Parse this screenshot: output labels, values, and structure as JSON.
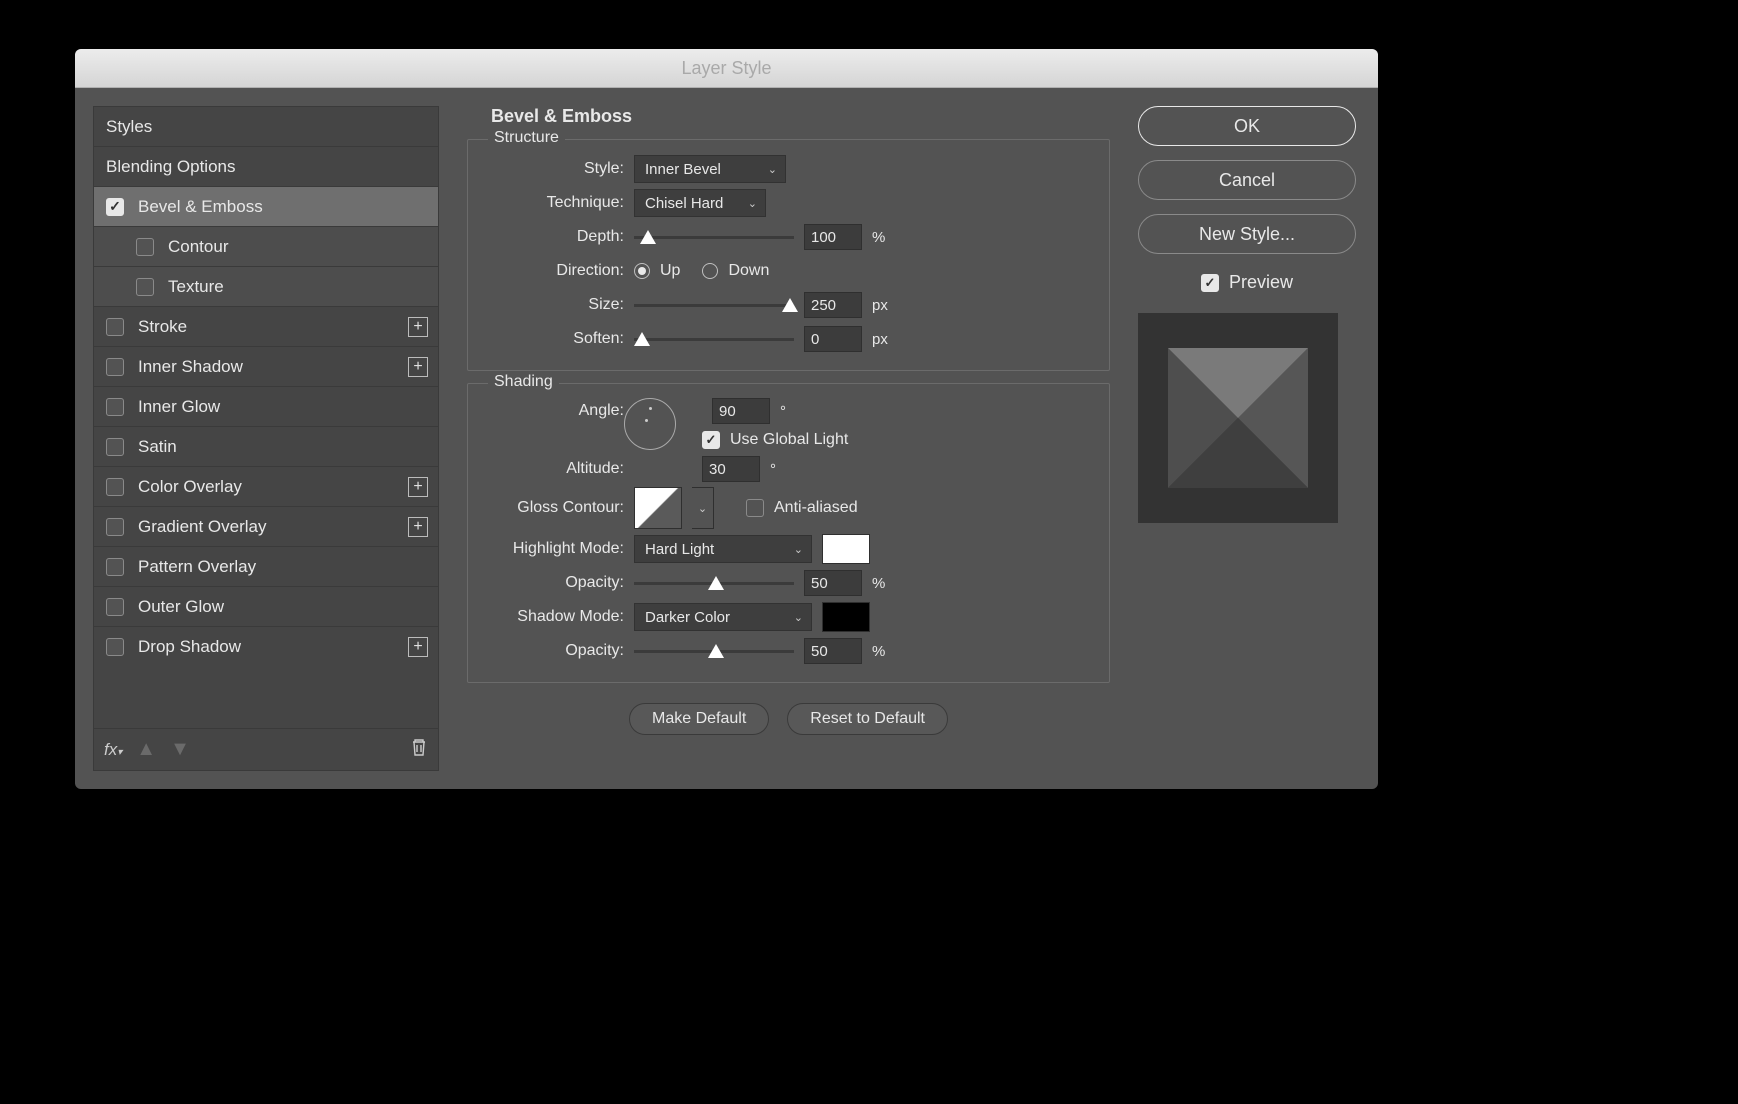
{
  "window": {
    "title": "Layer Style"
  },
  "sidebar": {
    "items": [
      {
        "label": "Styles",
        "checkbox": false
      },
      {
        "label": "Blending Options",
        "checkbox": false
      },
      {
        "label": "Bevel & Emboss",
        "checkbox": true,
        "checked": true,
        "selected": true
      },
      {
        "label": "Contour",
        "checkbox": true,
        "checked": false,
        "sub": true
      },
      {
        "label": "Texture",
        "checkbox": true,
        "checked": false,
        "sub": true
      },
      {
        "label": "Stroke",
        "checkbox": true,
        "checked": false,
        "addable": true
      },
      {
        "label": "Inner Shadow",
        "checkbox": true,
        "checked": false,
        "addable": true
      },
      {
        "label": "Inner Glow",
        "checkbox": true,
        "checked": false
      },
      {
        "label": "Satin",
        "checkbox": true,
        "checked": false
      },
      {
        "label": "Color Overlay",
        "checkbox": true,
        "checked": false,
        "addable": true
      },
      {
        "label": "Gradient Overlay",
        "checkbox": true,
        "checked": false,
        "addable": true
      },
      {
        "label": "Pattern Overlay",
        "checkbox": true,
        "checked": false
      },
      {
        "label": "Outer Glow",
        "checkbox": true,
        "checked": false
      },
      {
        "label": "Drop Shadow",
        "checkbox": true,
        "checked": false,
        "addable": true
      }
    ]
  },
  "panel": {
    "title": "Bevel & Emboss",
    "structure": {
      "legend": "Structure",
      "style_label": "Style:",
      "style_value": "Inner Bevel",
      "technique_label": "Technique:",
      "technique_value": "Chisel Hard",
      "depth_label": "Depth:",
      "depth_value": "100",
      "depth_unit": "%",
      "direction_label": "Direction:",
      "direction_up": "Up",
      "direction_down": "Down",
      "direction_value": "Up",
      "size_label": "Size:",
      "size_value": "250",
      "size_unit": "px",
      "soften_label": "Soften:",
      "soften_value": "0",
      "soften_unit": "px"
    },
    "shading": {
      "legend": "Shading",
      "angle_label": "Angle:",
      "angle_value": "90",
      "angle_unit": "°",
      "global_light_label": "Use Global Light",
      "global_light_checked": true,
      "altitude_label": "Altitude:",
      "altitude_value": "30",
      "altitude_unit": "°",
      "gloss_label": "Gloss Contour:",
      "antialiased_label": "Anti-aliased",
      "antialiased_checked": false,
      "highlight_mode_label": "Highlight Mode:",
      "highlight_mode_value": "Hard Light",
      "highlight_color": "#ffffff",
      "highlight_opacity_label": "Opacity:",
      "highlight_opacity_value": "50",
      "highlight_opacity_unit": "%",
      "shadow_mode_label": "Shadow Mode:",
      "shadow_mode_value": "Darker Color",
      "shadow_color": "#000000",
      "shadow_opacity_label": "Opacity:",
      "shadow_opacity_value": "50",
      "shadow_opacity_unit": "%"
    },
    "make_default": "Make Default",
    "reset_default": "Reset to Default"
  },
  "actions": {
    "ok": "OK",
    "cancel": "Cancel",
    "new_style": "New Style...",
    "preview": "Preview",
    "preview_checked": true
  }
}
